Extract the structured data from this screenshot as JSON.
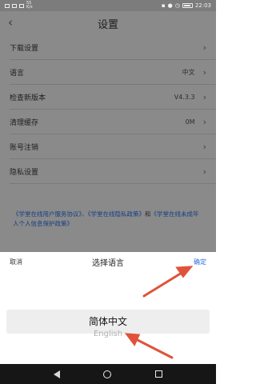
{
  "status_bar": {
    "left_text": "55\nK/s",
    "time": "22:03",
    "battery": "87"
  },
  "settings": {
    "title": "设置",
    "rows": [
      {
        "label": "下载设置",
        "value": ""
      },
      {
        "label": "语言",
        "value": "中文"
      },
      {
        "label": "检查新版本",
        "value": "V4.3.3"
      },
      {
        "label": "清理缓存",
        "value": "0M"
      },
      {
        "label": "账号注销",
        "value": ""
      },
      {
        "label": "隐私设置",
        "value": ""
      }
    ],
    "policy": {
      "link1": "《学堂在线用户服务协议》",
      "sep1": "、",
      "link2": "《学堂在线隐私政策》",
      "sep2": "和",
      "link3": "《学堂在线未成年人个人信息保护政策》"
    }
  },
  "sheet": {
    "cancel": "取消",
    "title": "选择语言",
    "confirm": "确定",
    "options": [
      "简体中文",
      "English"
    ]
  },
  "colors": {
    "accent": "#2f6de0",
    "annotation": "#e0533a"
  }
}
